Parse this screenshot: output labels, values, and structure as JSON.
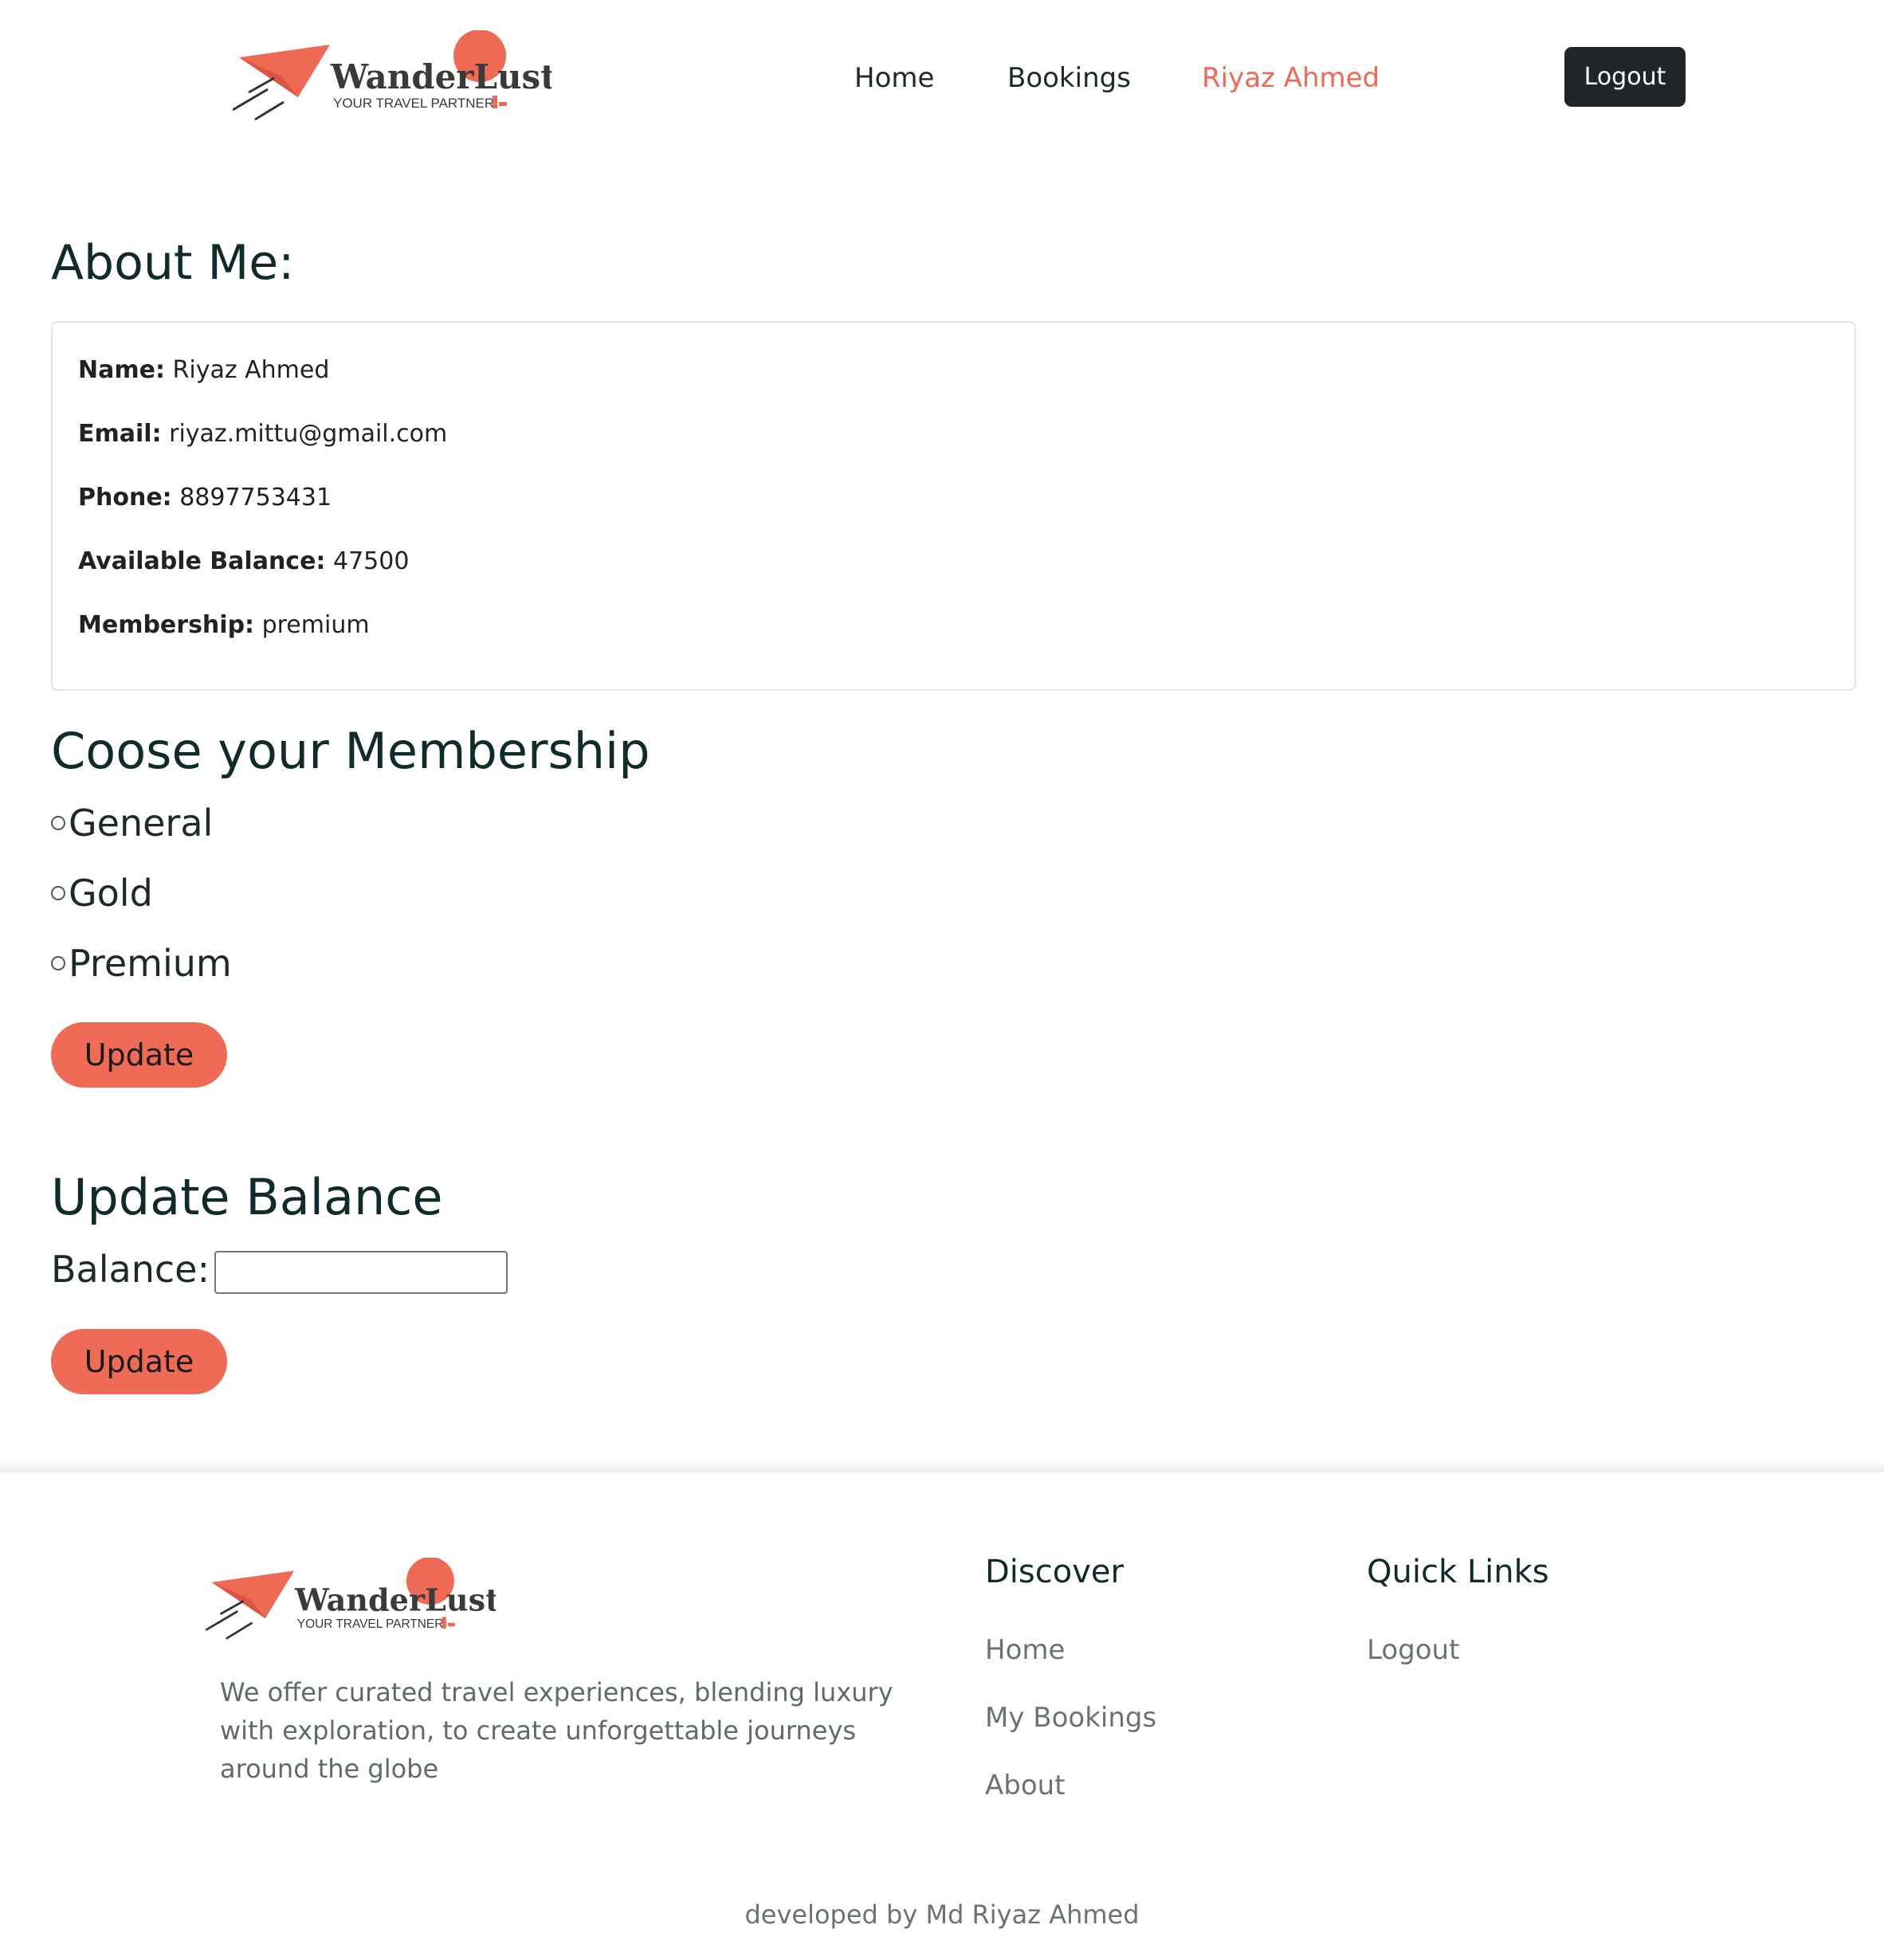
{
  "brand": {
    "name": "WanderLust",
    "tagline": "YOUR TRAVEL PARTNER"
  },
  "header": {
    "nav": {
      "home": "Home",
      "bookings": "Bookings",
      "user": "Riyaz Ahmed"
    },
    "logout_label": "Logout"
  },
  "about": {
    "title": "About Me:",
    "name_label": "Name:",
    "name_value": "Riyaz Ahmed",
    "email_label": "Email:",
    "email_value": "riyaz.mittu@gmail.com",
    "phone_label": "Phone:",
    "phone_value": "8897753431",
    "balance_label": "Available Balance:",
    "balance_value": "47500",
    "membership_label": "Membership:",
    "membership_value": "premium"
  },
  "membership_form": {
    "title": "Coose your Membership",
    "options": [
      "General",
      "Gold",
      "Premium"
    ],
    "update_label": "Update"
  },
  "balance_form": {
    "title": "Update Balance",
    "field_label": "Balance:",
    "field_value": "",
    "update_label": "Update"
  },
  "footer": {
    "description": "We offer curated travel experiences, blending luxury with exploration, to create unforgettable journeys around the globe",
    "discover": {
      "title": "Discover",
      "links": [
        "Home",
        "My Bookings",
        "About"
      ]
    },
    "quick_links": {
      "title": "Quick Links",
      "links": [
        "Logout"
      ]
    },
    "credit": "developed by Md Riyaz Ahmed"
  },
  "colors": {
    "accent": "#ee6a55",
    "button": "#f06b56",
    "dark": "#212529",
    "heading": "#0f2b2a"
  }
}
